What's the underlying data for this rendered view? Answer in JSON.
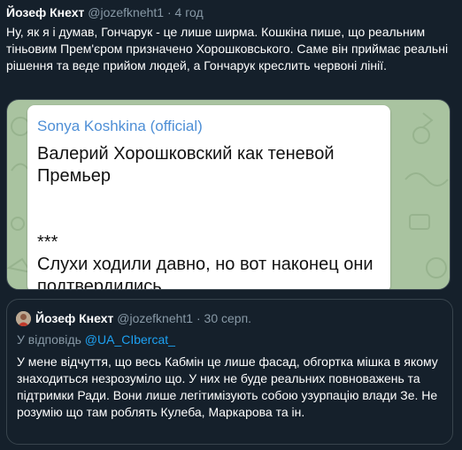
{
  "tweet": {
    "display_name": "Йозеф Кнехт",
    "handle": "@jozefkneht1",
    "separator": "·",
    "time": "4 год",
    "text": "Ну, як я і думав, Гончарук - це лише ширма. Кошкіна пише, що реальним тіньовим Прем'єром призначено Хорошковського. Саме він приймає реальні рішення та веде прийом людей, а Гончарук креслить червоні лінії."
  },
  "media": {
    "author": "Sonya Koshkina (official)",
    "line1": "Валерий Хорошковский как теневой Премьер",
    "stars": "***",
    "line2": "Слухи ходили давно, но вот наконец они подтвердились."
  },
  "quote": {
    "display_name": "Йозеф Кнехт",
    "handle": "@jozefkneht1",
    "separator": "·",
    "time": "30 серп.",
    "reply_prefix": "У відповідь",
    "reply_to": "@UA_CIbercat_",
    "text": "У мене відчуття, що весь Кабмін це лише фасад, обгортка мішка в якому знаходиться незрозуміло що. У них не буде реальних повноважень та підтримки Ради. Вони лише легітимізують собою узурпацію влади Зе. Не розумію що там роблять Кулеба, Маркарова та ін."
  },
  "colors": {
    "background": "#15202b",
    "muted": "#8899a6",
    "link": "#1da1f2",
    "border": "#38444d"
  },
  "icons": {
    "media_background": "telegram-pattern",
    "avatar": "user-avatar"
  }
}
